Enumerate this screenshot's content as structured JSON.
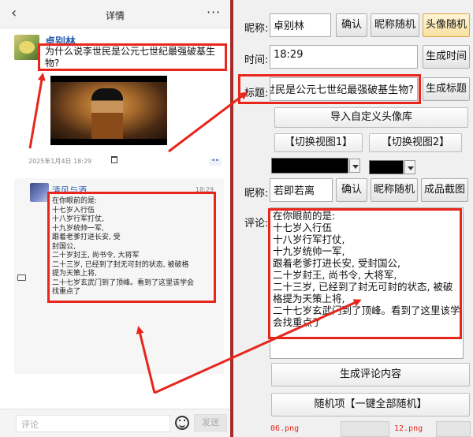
{
  "phone": {
    "back_glyph": "‹",
    "title": "详情",
    "more_glyph": "···",
    "post": {
      "name": "卓别林",
      "title": "为什么说李世民是公元七世纪最强破基生物?",
      "meta": "2025年1月4日  18:29",
      "more_glyph": "••"
    },
    "comment": {
      "name": "清风与酒",
      "time": "18:29",
      "text": "在你眼前的是:\n十七岁入行伍\n十八岁行军打仗,\n十九岁统帅一军,\n跟着老爹打进长安, 受\n封国公,\n二十岁封王, 尚书令, 大将军\n二十三岁, 已经到了封无可封的状态, 被破格\n提为天策上将,\n二十七岁玄武门到了顶峰。看到了这里该学会\n找重点了"
    },
    "input_placeholder": "评论",
    "send_label": "发送"
  },
  "panel": {
    "nickname_label": "昵称:",
    "nickname_value": "卓别林",
    "confirm_label": "确认",
    "nickname_random_label": "昵称随机",
    "avatar_random_label": "头像随机",
    "time_label": "时间:",
    "time_value": "18:29",
    "gen_time_label": "生成时间",
    "title_label": "标题:",
    "title_value": "李世民是公元七世纪最强破基生物?",
    "gen_title_label": "生成标题",
    "import_avatar_label": "导入自定义头像库",
    "view1_label": "【切换视图1】",
    "view2_label": "【切换视图2】",
    "c_nickname_label": "昵称:",
    "c_nickname_value": "若即若离",
    "c_confirm_label": "确认",
    "c_nickname_random_label": "昵称随机",
    "screenshot_label": "成品截图",
    "comment_label": "评论:",
    "comment_value": "在你眼前的是:\n十七岁入行伍\n十八岁行军打仗,\n十九岁统帅一军,\n跟着老爹打进长安, 受封国公,\n二十岁封王, 尚书令, 大将军,\n二十三岁, 已经到了封无可封的状态, 被破\n格提为天策上将,\n二十七岁玄武门到了顶峰。看到了这里该学\n会找重点了",
    "gen_comment_label": "生成评论内容",
    "random_all_label": "随机项【一键全部随机】"
  },
  "bottom_files": [
    "06.png",
    "12.png"
  ],
  "colors": {
    "accent_red": "#e8261c",
    "name_blue": "#2a5db0",
    "left_border": "#a52a2a"
  },
  "icons": [
    "back-icon",
    "more-icon",
    "trash-icon",
    "chat-icon",
    "emoji-icon",
    "dropdown-icon"
  ]
}
